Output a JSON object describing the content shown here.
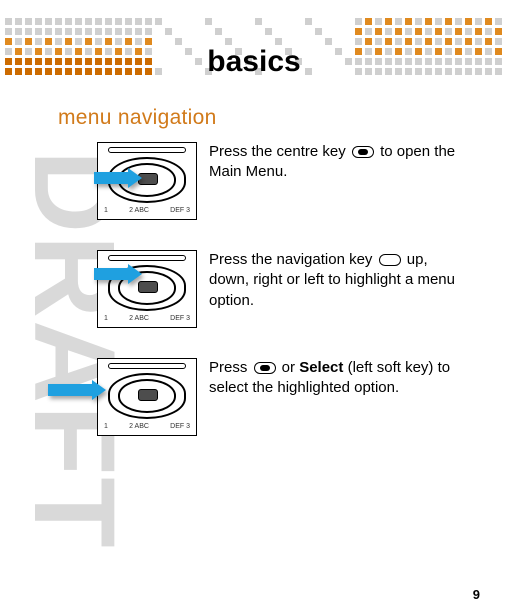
{
  "watermark": "DRAFT",
  "title": "basics",
  "section_heading": "menu navigation",
  "steps": [
    {
      "pre": "Press the centre key ",
      "post": " to open the Main Menu.",
      "icon": "center"
    },
    {
      "pre": "Press the navigation key ",
      "post": " up, down, right or left to highlight a menu option.",
      "icon": "nav"
    },
    {
      "pre": "Press ",
      "mid": " or ",
      "bold": "Select",
      "post": " (left soft key) to select the highlighted option.",
      "icon": "center"
    }
  ],
  "keypad_row": [
    "1",
    "2 ABC",
    "DEF 3"
  ],
  "page_number": "9"
}
